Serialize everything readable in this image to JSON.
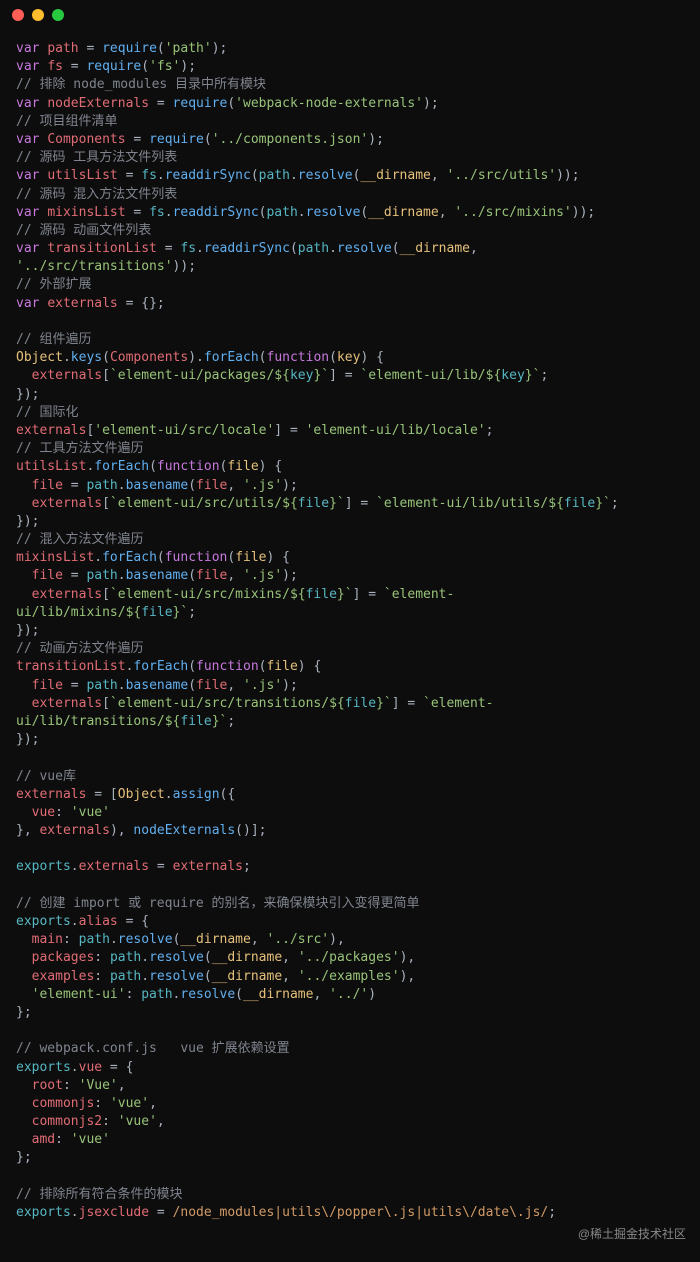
{
  "titlebar": {
    "buttons": [
      "close",
      "minimize",
      "maximize"
    ]
  },
  "watermark": "@稀土掘金技术社区",
  "code": {
    "l1": {
      "kw": "var",
      "v": "path",
      "eq": " = ",
      "fn": "require",
      "p1": "(",
      "str": "'path'",
      "p2": ");"
    },
    "l2": {
      "kw": "var",
      "v": "fs",
      "eq": " = ",
      "fn": "require",
      "p1": "(",
      "str": "'fs'",
      "p2": ");"
    },
    "l3": {
      "cmt": "// 排除 node_modules 目录中所有模块"
    },
    "l4": {
      "kw": "var",
      "v": "nodeExternals",
      "eq": " = ",
      "fn": "require",
      "p1": "(",
      "str": "'webpack-node-externals'",
      "p2": ");"
    },
    "l5": {
      "cmt": "// 项目组件清单"
    },
    "l6": {
      "kw": "var",
      "v": "Components",
      "eq": " = ",
      "fn": "require",
      "p1": "(",
      "str": "'../components.json'",
      "p2": ");"
    },
    "l7": {
      "cmt": "// 源码 工具方法文件列表"
    },
    "l8": {
      "kw": "var",
      "v": "utilsList",
      "eq": " = ",
      "o": "fs",
      "d": ".",
      "fn": "readdirSync",
      "p1": "(",
      "o2": "path",
      "d2": ".",
      "fn2": "resolve",
      "p2": "(",
      "g": "__dirname",
      "c": ", ",
      "str": "'../src/utils'",
      "p3": "));"
    },
    "l9": {
      "cmt": "// 源码 混入方法文件列表"
    },
    "l10": {
      "kw": "var",
      "v": "mixinsList",
      "eq": " = ",
      "o": "fs",
      "d": ".",
      "fn": "readdirSync",
      "p1": "(",
      "o2": "path",
      "d2": ".",
      "fn2": "resolve",
      "p2": "(",
      "g": "__dirname",
      "c": ", ",
      "str": "'../src/mixins'",
      "p3": "));"
    },
    "l11": {
      "cmt": "// 源码 动画文件列表"
    },
    "l12a": {
      "kw": "var",
      "v": "transitionList",
      "eq": " = ",
      "o": "fs",
      "d": ".",
      "fn": "readdirSync",
      "p1": "(",
      "o2": "path",
      "d2": ".",
      "fn2": "resolve",
      "p2": "(",
      "g": "__dirname",
      "c": ","
    },
    "l12b": {
      "str": "'../src/transitions'",
      "p": "));"
    },
    "l13": {
      "cmt": "// 外部扩展"
    },
    "l14": {
      "kw": "var",
      "v": "externals",
      "eq": " = {};"
    },
    "l16": {
      "cmt": "// 组件遍历"
    },
    "l17": {
      "o": "Object",
      "d": ".",
      "fn": "keys",
      "p1": "(",
      "v": "Components",
      "p2": ").",
      "fn2": "forEach",
      "p3": "(",
      "kw": "function",
      "p4": "(",
      "pm": "key",
      "p5": ") {"
    },
    "l18": {
      "sp": "  ",
      "v": "externals",
      "p1": "[",
      "t1": "`element-ui/packages/${",
      "pm": "key",
      "t2": "}`",
      "p2": "] = ",
      "t3": "`element-ui/lib/${",
      "pm2": "key",
      "t4": "}`",
      "p3": ";"
    },
    "l19": {
      "p": "});"
    },
    "l20": {
      "cmt": "// 国际化"
    },
    "l21": {
      "v": "externals",
      "p1": "[",
      "s1": "'element-ui/src/locale'",
      "p2": "] = ",
      "s2": "'element-ui/lib/locale'",
      "p3": ";"
    },
    "l22": {
      "cmt": "// 工具方法文件遍历"
    },
    "l23": {
      "v": "utilsList",
      "d": ".",
      "fn": "forEach",
      "p1": "(",
      "kw": "function",
      "p2": "(",
      "pm": "file",
      "p3": ") {"
    },
    "l24": {
      "sp": "  ",
      "v": "file",
      "eq": " = ",
      "o": "path",
      "d": ".",
      "fn": "basename",
      "p1": "(",
      "pm": "file",
      "c": ", ",
      "s": "'.js'",
      "p2": ");"
    },
    "l25": {
      "sp": "  ",
      "v": "externals",
      "p1": "[",
      "t1": "`element-ui/src/utils/${",
      "pm": "file",
      "t2": "}`",
      "p2": "] = ",
      "t3": "`element-ui/lib/utils/${",
      "pm2": "file",
      "t4": "}`",
      "p3": ";"
    },
    "l26": {
      "p": "});"
    },
    "l27": {
      "cmt": "// 混入方法文件遍历"
    },
    "l28": {
      "v": "mixinsList",
      "d": ".",
      "fn": "forEach",
      "p1": "(",
      "kw": "function",
      "p2": "(",
      "pm": "file",
      "p3": ") {"
    },
    "l29": {
      "sp": "  ",
      "v": "file",
      "eq": " = ",
      "o": "path",
      "d": ".",
      "fn": "basename",
      "p1": "(",
      "pm": "file",
      "c": ", ",
      "s": "'.js'",
      "p2": ");"
    },
    "l30a": {
      "sp": "  ",
      "v": "externals",
      "p1": "[",
      "t1": "`element-ui/src/mixins/${",
      "pm": "file",
      "t2": "}`",
      "p2": "] = ",
      "t3": "`element-"
    },
    "l30b": {
      "t": "ui/lib/mixins/${",
      "pm": "file",
      "t2": "}`",
      "p": ";"
    },
    "l31": {
      "p": "});"
    },
    "l32": {
      "cmt": "// 动画方法文件遍历"
    },
    "l33": {
      "v": "transitionList",
      "d": ".",
      "fn": "forEach",
      "p1": "(",
      "kw": "function",
      "p2": "(",
      "pm": "file",
      "p3": ") {"
    },
    "l34": {
      "sp": "  ",
      "v": "file",
      "eq": " = ",
      "o": "path",
      "d": ".",
      "fn": "basename",
      "p1": "(",
      "pm": "file",
      "c": ", ",
      "s": "'.js'",
      "p2": ");"
    },
    "l35a": {
      "sp": "  ",
      "v": "externals",
      "p1": "[",
      "t1": "`element-ui/src/transitions/${",
      "pm": "file",
      "t2": "}`",
      "p2": "] = ",
      "t3": "`element-"
    },
    "l35b": {
      "t": "ui/lib/transitions/${",
      "pm": "file",
      "t2": "}`",
      "p": ";"
    },
    "l36": {
      "p": "});"
    },
    "l38": {
      "cmt": "// vue库"
    },
    "l39": {
      "v": "externals",
      "eq": " = [",
      "o": "Object",
      "d": ".",
      "fn": "assign",
      "p": "({"
    },
    "l40": {
      "sp": "  ",
      "k": "vue",
      "c": ": ",
      "s": "'vue'"
    },
    "l41": {
      "p1": "}, ",
      "v": "externals",
      "p2": "), ",
      "fn": "nodeExternals",
      "p3": "()];"
    },
    "l43": {
      "o": "exports",
      "d": ".",
      "v": "externals",
      "eq": " = ",
      "v2": "externals",
      "p": ";"
    },
    "l45": {
      "cmt": "// 创建 import 或 require 的别名，来确保模块引入变得更简单"
    },
    "l46": {
      "o": "exports",
      "d": ".",
      "v": "alias",
      "eq": " = {"
    },
    "l47": {
      "sp": "  ",
      "k": "main",
      "c": ": ",
      "o": "path",
      "d": ".",
      "fn": "resolve",
      "p1": "(",
      "g": "__dirname",
      "cm": ", ",
      "s": "'../src'",
      "p2": "),"
    },
    "l48": {
      "sp": "  ",
      "k": "packages",
      "c": ": ",
      "o": "path",
      "d": ".",
      "fn": "resolve",
      "p1": "(",
      "g": "__dirname",
      "cm": ", ",
      "s": "'../packages'",
      "p2": "),"
    },
    "l49": {
      "sp": "  ",
      "k": "examples",
      "c": ": ",
      "o": "path",
      "d": ".",
      "fn": "resolve",
      "p1": "(",
      "g": "__dirname",
      "cm": ", ",
      "s": "'../examples'",
      "p2": "),"
    },
    "l50": {
      "sp": "  ",
      "s1": "'element-ui'",
      "c": ": ",
      "o": "path",
      "d": ".",
      "fn": "resolve",
      "p1": "(",
      "g": "__dirname",
      "cm": ", ",
      "s": "'../'",
      "p2": ")"
    },
    "l51": {
      "p": "};"
    },
    "l53": {
      "cmt": "// webpack.conf.js   vue 扩展依赖设置"
    },
    "l54": {
      "o": "exports",
      "d": ".",
      "v": "vue",
      "eq": " = {"
    },
    "l55": {
      "sp": "  ",
      "k": "root",
      "c": ": ",
      "s": "'Vue'",
      "cm": ","
    },
    "l56": {
      "sp": "  ",
      "k": "commonjs",
      "c": ": ",
      "s": "'vue'",
      "cm": ","
    },
    "l57": {
      "sp": "  ",
      "k": "commonjs2",
      "c": ": ",
      "s": "'vue'",
      "cm": ","
    },
    "l58": {
      "sp": "  ",
      "k": "amd",
      "c": ": ",
      "s": "'vue'"
    },
    "l59": {
      "p": "};"
    },
    "l61": {
      "cmt": "// 排除所有符合条件的模块"
    },
    "l62": {
      "o": "exports",
      "d": ".",
      "v": "jsexclude",
      "eq": " = ",
      "rx": "/node_modules|utils\\/popper\\.js|utils\\/date\\.js/",
      "p": ";"
    }
  }
}
